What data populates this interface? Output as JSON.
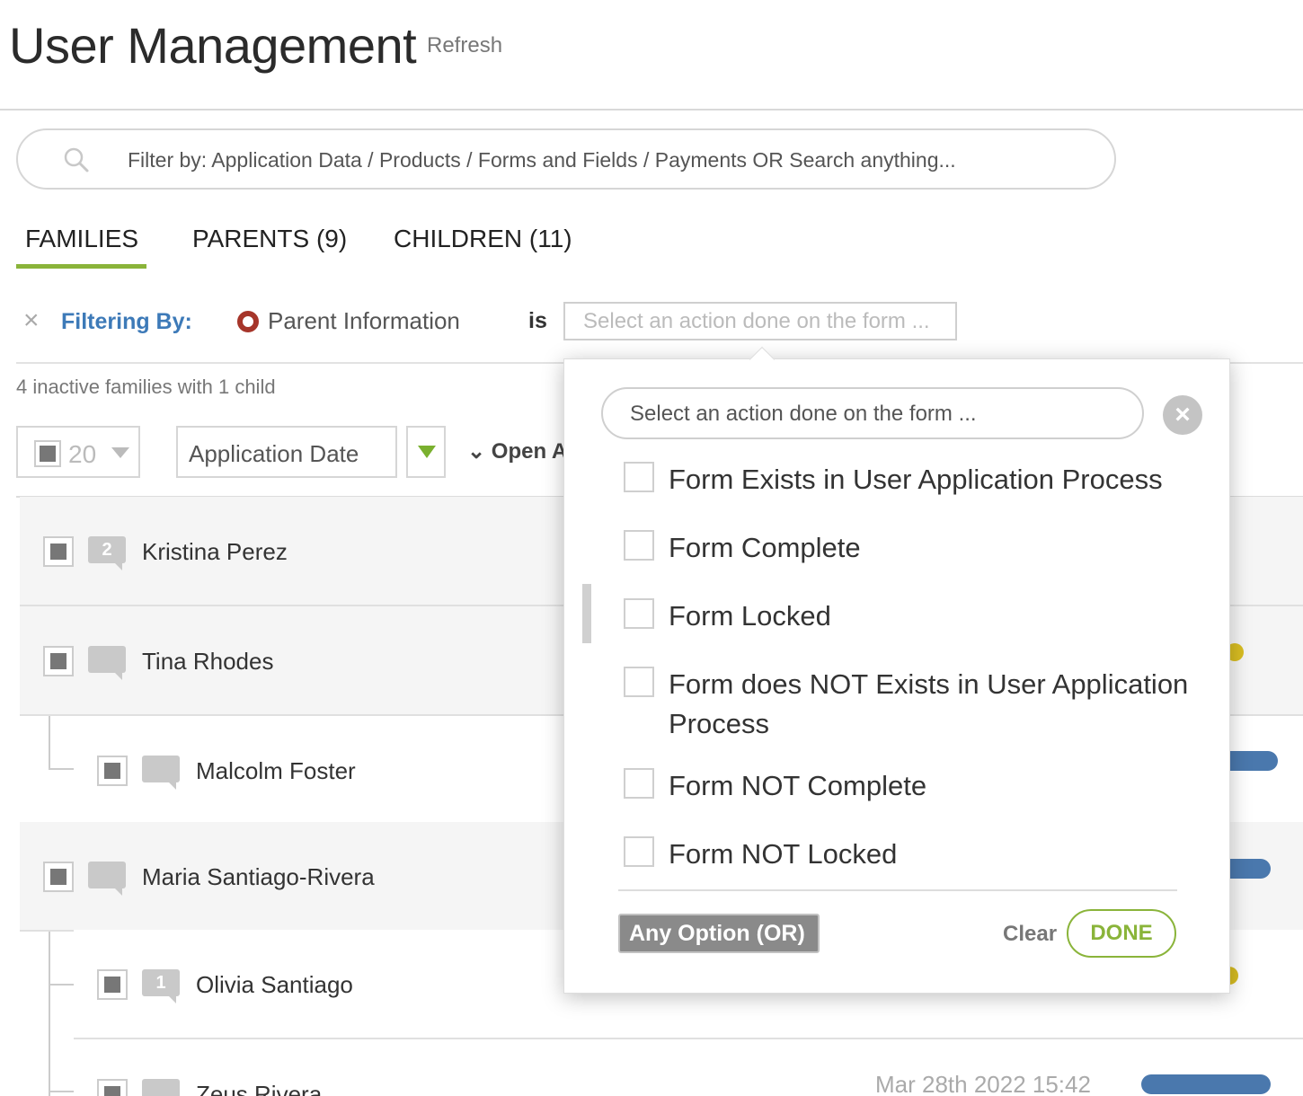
{
  "header": {
    "title": "User Management",
    "refresh_label": "Refresh"
  },
  "search": {
    "placeholder": "Filter by: Application Data / Products / Forms and Fields / Payments OR Search anything...",
    "icon": "search-icon"
  },
  "tabs": [
    {
      "label": "FAMILIES",
      "active": true
    },
    {
      "label": "PARENTS (9)",
      "active": false
    },
    {
      "label": "CHILDREN (11)",
      "active": false
    }
  ],
  "filter": {
    "close_icon": "close-icon",
    "label": "Filtering By:",
    "field": "Parent Information",
    "operator": "is",
    "select_placeholder": "Select an action done on the form ..."
  },
  "summary": "4 inactive families with 1 child",
  "controls": {
    "page_size": "20",
    "sort_field": "Application Date",
    "open_all": "Open A"
  },
  "rows": [
    {
      "name": "Kristina Perez",
      "badge": "2",
      "type": "family"
    },
    {
      "name": "Tina Rhodes",
      "badge": "",
      "type": "family"
    },
    {
      "name": "Malcolm Foster",
      "badge": "",
      "type": "child"
    },
    {
      "name": "Maria Santiago-Rivera",
      "badge": "",
      "type": "family"
    },
    {
      "name": "Olivia Santiago",
      "badge": "1",
      "type": "child"
    },
    {
      "name": "Zeus Rivera",
      "badge": "",
      "type": "child"
    }
  ],
  "last_row_date": "Mar 28th 2022 15:42",
  "colors": {
    "accent_green": "#8ab43a",
    "filter_blue": "#3d7ab8",
    "radio_red": "#a6352a",
    "status_blue": "#4a78ad",
    "status_yellow": "#d8bd22"
  },
  "popup": {
    "search_placeholder": "Select an action done on the form ...",
    "options": [
      "Form Exists in User Application Process",
      "Form Complete",
      "Form Locked",
      "Form does NOT Exists in User Application Process",
      "Form NOT Complete",
      "Form NOT Locked"
    ],
    "any_option_label": "Any Option (OR)",
    "clear_label": "Clear",
    "done_label": "DONE"
  }
}
